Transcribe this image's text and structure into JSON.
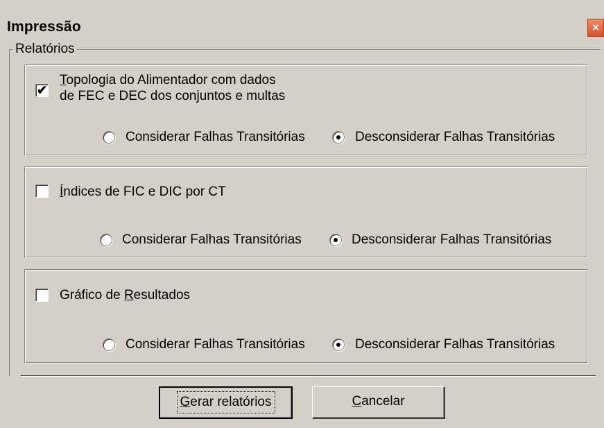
{
  "window": {
    "title": "Impressão",
    "close": "×"
  },
  "group": {
    "label": "Relatórios"
  },
  "options": [
    {
      "checked": true,
      "label_line1_first": "T",
      "label_line1_rest": "opologia do Alimentador com dados",
      "label_line2": "de FEC e DEC dos conjuntos e multas",
      "radio_consider": "Considerar Falhas Transitórias",
      "radio_ignore": "Desconsiderar Falhas Transitórias",
      "selected": "ignore"
    },
    {
      "checked": false,
      "label_first": "Í",
      "label_rest": "ndices de FIC e DIC por CT",
      "radio_consider": "Considerar Falhas Transitórias",
      "radio_ignore": "Desconsiderar Falhas Transitórias",
      "selected": "ignore"
    },
    {
      "checked": false,
      "label_pre": "Gráfico de ",
      "label_u": "R",
      "label_post": "esultados",
      "radio_consider": "Considerar Falhas Transitórias",
      "radio_ignore": "Desconsiderar Falhas Transitórias",
      "selected": "ignore"
    }
  ],
  "buttons": {
    "generate_u": "G",
    "generate_rest": "erar relatórios",
    "cancel_u": "C",
    "cancel_rest": "ancelar"
  },
  "checkmark": "✔"
}
